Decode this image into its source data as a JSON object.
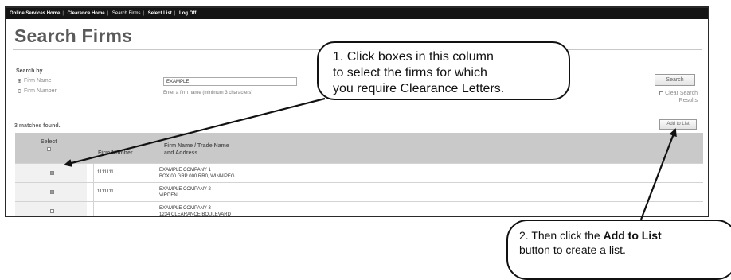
{
  "nav": [
    "Online Services Home",
    "Clearance Home",
    "Search Firms",
    "Select List",
    "Log Off"
  ],
  "page": {
    "title": "Search Firms"
  },
  "search": {
    "by_label": "Search by",
    "option_firm_name": "Firm Name",
    "option_firm_number": "Firm Number",
    "input_value": "EXAMPLE",
    "hint": "Enter a firm name (minimum 3 characters)",
    "search_button": "Search",
    "clear_label_line1": "Clear Search",
    "clear_label_line2": "Results"
  },
  "results": {
    "count_text": "3 matches found.",
    "add_button": "Add to List",
    "headers": {
      "select": "Select",
      "firm_number": "Firm Number",
      "name_line1": "Firm Name / Trade Name",
      "name_line2": "and Address"
    },
    "rows": [
      {
        "firm_number": "1111111",
        "name": "EXAMPLE COMPANY 1",
        "address": "BOX 00 GRP 000 RR0, WINNIPEG",
        "checked": true
      },
      {
        "firm_number": "1111111",
        "name": "EXAMPLE COMPANY 2",
        "address": "VIRDEN",
        "checked": true
      },
      {
        "firm_number": "",
        "name": "EXAMPLE COMPANY 3",
        "address": "1234 CLEARANCE BOULEVARD",
        "checked": false
      }
    ]
  },
  "callouts": {
    "one_line1": "1. Click boxes in this column",
    "one_line2": "to select the firms for which",
    "one_line3": "you require Clearance Letters.",
    "two_pre": "2. Then click the ",
    "two_bold": "Add to List",
    "two_line2": "button to create a list."
  }
}
